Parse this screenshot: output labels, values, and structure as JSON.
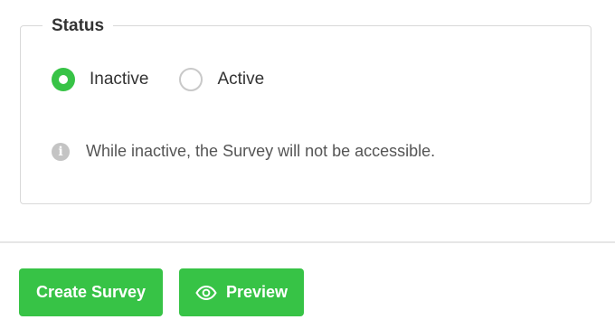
{
  "status_section": {
    "legend": "Status",
    "options": [
      {
        "label": "Inactive",
        "selected": true
      },
      {
        "label": "Active",
        "selected": false
      }
    ],
    "info_text": "While inactive, the Survey will not be accessible."
  },
  "actions": {
    "create_label": "Create Survey",
    "preview_label": "Preview"
  },
  "colors": {
    "accent_green": "#37c346",
    "border": "#d9d9d9",
    "info_icon": "#c4c4c4"
  },
  "icons": {
    "info": "info-icon",
    "preview": "eye-icon"
  }
}
